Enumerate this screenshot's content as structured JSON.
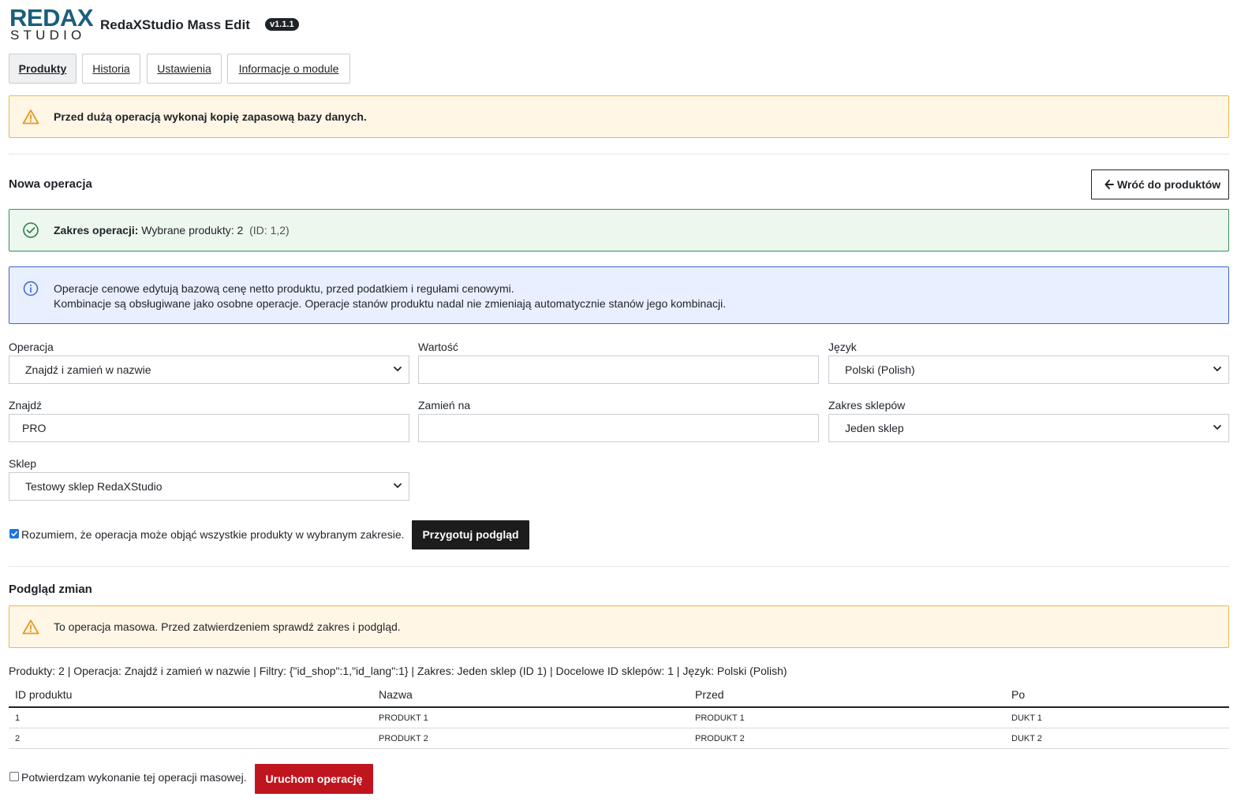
{
  "header": {
    "logo_top": "REDAX",
    "logo_bottom": "STUDIO",
    "title": "RedaXStudio Mass Edit",
    "version": "v1.1.1"
  },
  "tabs": [
    {
      "label": "Produkty",
      "active": true
    },
    {
      "label": "Historia",
      "active": false
    },
    {
      "label": "Ustawienia",
      "active": false
    },
    {
      "label": "Informacje o module",
      "active": false
    }
  ],
  "backup_alert": {
    "text": "Przed dużą operacją wykonaj kopię zapasową bazy danych.",
    "icon": "warning-triangle-icon"
  },
  "new_operation": {
    "title": "Nowa operacja",
    "back_button": "Wróć do produktów",
    "back_icon": "arrow-left-icon"
  },
  "scope_alert": {
    "label": "Zakres operacji:",
    "text": "Wybrane produkty: 2",
    "ids": "(ID: 1,2)",
    "icon": "check-circle-icon"
  },
  "info_alert": {
    "line1": "Operacje cenowe edytują bazową cenę netto produktu, przed podatkiem i regułami cenowymi.",
    "line2": "Kombinacje są obsługiwane jako osobne operacje. Operacje stanów produktu nadal nie zmieniają automatycznie stanów jego kombinacji.",
    "icon": "info-circle-icon"
  },
  "form": {
    "operation_label": "Operacja",
    "operation_value": "Znajdź i zamień w nazwie",
    "value_label": "Wartość",
    "value_value": "",
    "language_label": "Język",
    "language_value": "Polski (Polish)",
    "find_label": "Znajdź",
    "find_value": "PRO",
    "replace_label": "Zamień na",
    "replace_value": "",
    "shop_scope_label": "Zakres sklepów",
    "shop_scope_value": "Jeden sklep",
    "shop_label": "Sklep",
    "shop_value": "Testowy sklep RedaXStudio",
    "understand_checked": true,
    "understand_text": "Rozumiem, że operacja może objąć wszystkie produkty w wybranym zakresie.",
    "prepare_button": "Przygotuj podgląd"
  },
  "preview": {
    "title": "Podgląd zmian",
    "warning": "To operacja masowa. Przed zatwierdzeniem sprawdź zakres i podgląd.",
    "summary": "Produkty: 2 | Operacja: Znajdź i zamień w nazwie | Filtry: {\"id_shop\":1,\"id_lang\":1} | Zakres: Jeden sklep (ID 1) | Docelowe ID sklepów: 1 | Język: Polski (Polish)",
    "columns": [
      "ID produktu",
      "Nazwa",
      "Przed",
      "Po"
    ],
    "rows": [
      [
        "1",
        "PRODUKT 1",
        "PRODUKT 1",
        "DUKT 1"
      ],
      [
        "2",
        "PRODUKT 2",
        "PRODUKT 2",
        "DUKT 2"
      ]
    ]
  },
  "confirm": {
    "checked": false,
    "text": "Potwierdzam wykonanie tej operacji masowej.",
    "run_button": "Uruchom operację"
  },
  "colors": {
    "brand": "#1b5e7e",
    "warn_bg": "#fff6e6",
    "warn_border": "#e9b949",
    "success_bg": "#ecf7ee",
    "success_border": "#3a8b5a",
    "info_bg": "#e8efff",
    "info_border": "#3d63c9",
    "danger": "#c0151e"
  }
}
